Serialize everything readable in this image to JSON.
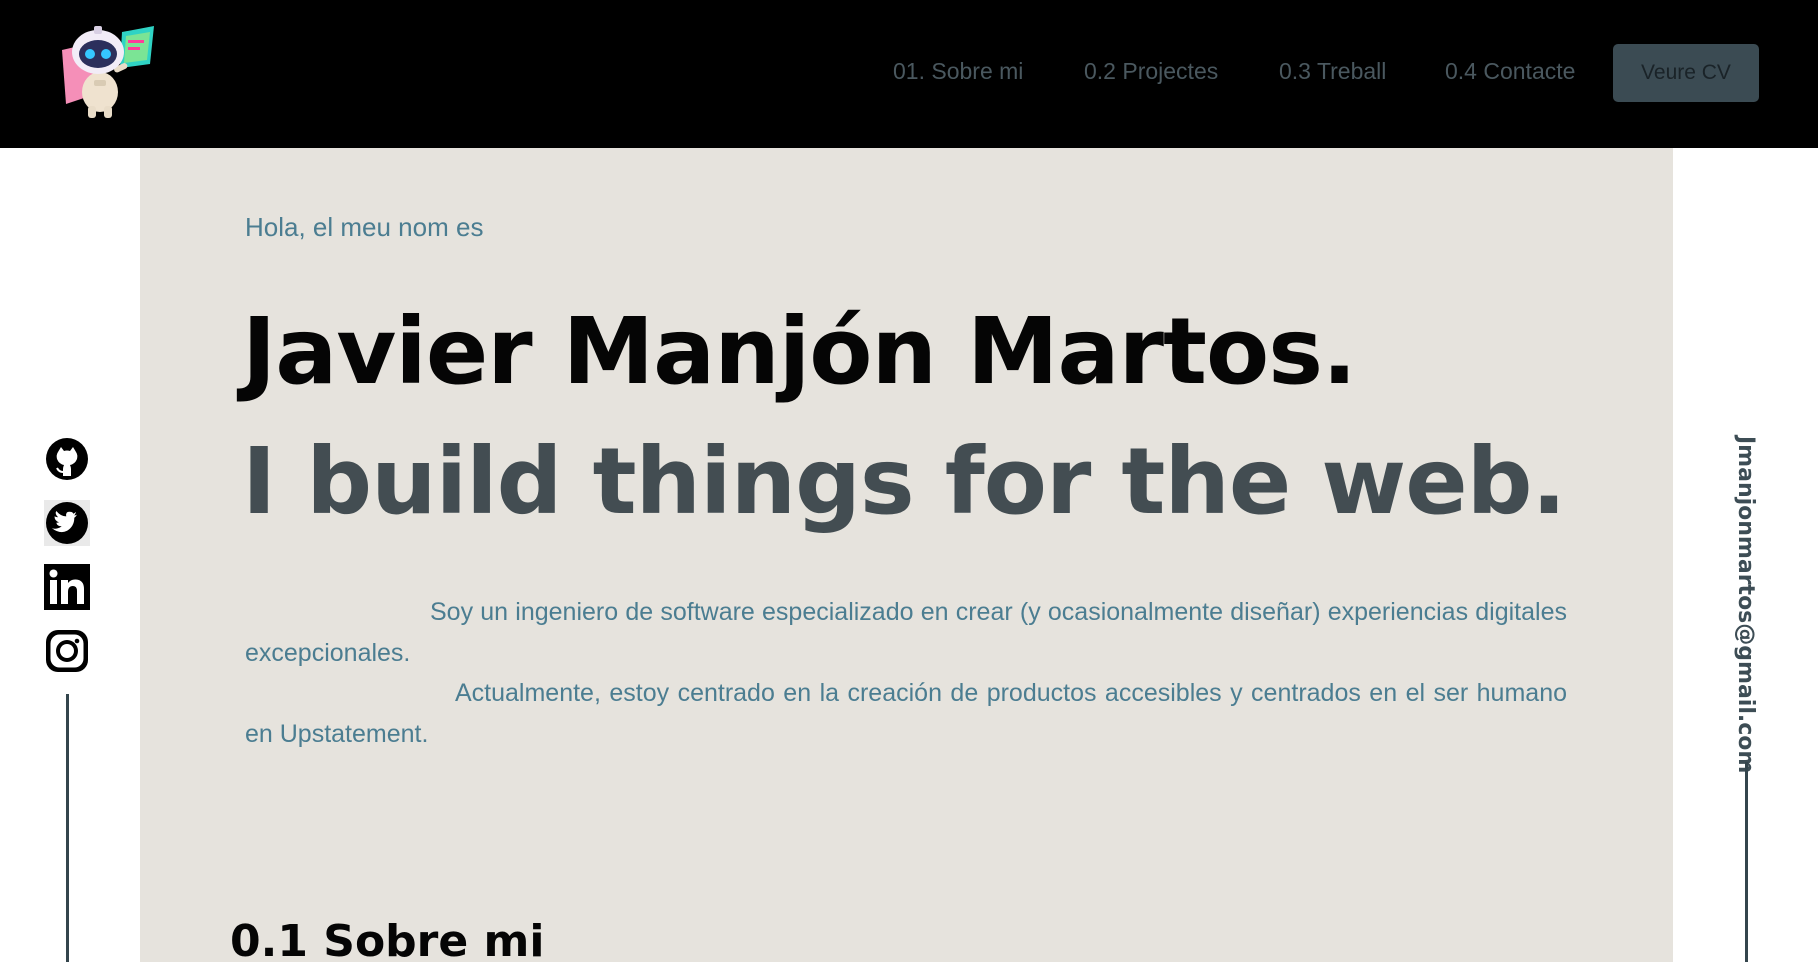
{
  "nav": {
    "items": [
      {
        "label": "01. Sobre mi"
      },
      {
        "label": "0.2 Projectes"
      },
      {
        "label": "0.3 Treball"
      },
      {
        "label": "0.4 Contacte"
      }
    ],
    "cv_button": "Veure CV"
  },
  "hero": {
    "greeting": "Hola, el meu nom es",
    "name": "Javier Manjón Martos.",
    "tagline": "I build things for the web.",
    "paragraphs": [
      "Soy un ingeniero de software especializado en crear (y ocasionalmente diseñar) experiencias digitales excepcionales.",
      "Actualmente, estoy centrado en la creación de productos accesibles y centrados en el ser humano en Upstatement."
    ]
  },
  "section": {
    "title": "0.1 Sobre mi"
  },
  "social": {
    "icons": [
      "github-icon",
      "twitter-icon",
      "linkedin-icon",
      "instagram-icon"
    ]
  },
  "contact": {
    "email": "Jmanjonmartos@gmail.com"
  },
  "colors": {
    "nav_bg": "#000000",
    "card_bg": "#e6e3dd",
    "accent": "#4b7d91",
    "button_bg": "#3b4b53",
    "name": "#050505",
    "tagline": "#434d52"
  }
}
